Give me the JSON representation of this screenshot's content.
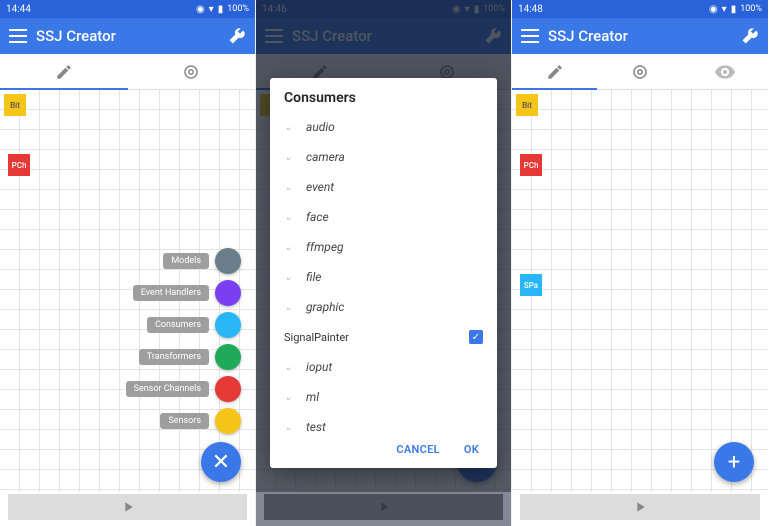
{
  "screens": [
    {
      "time": "14:44",
      "battery": "100%"
    },
    {
      "time": "14:46",
      "battery": "100%"
    },
    {
      "time": "14:48",
      "battery": "100%"
    }
  ],
  "app": {
    "title": "SSJ Creator"
  },
  "nodes": {
    "bit": "Bit",
    "pch": "PCh",
    "spa": "SPa"
  },
  "palette": [
    {
      "label": "Models",
      "color": "#6b7d8a"
    },
    {
      "label": "Event Handlers",
      "color": "#7b3ff2"
    },
    {
      "label": "Consumers",
      "color": "#29b6f6"
    },
    {
      "label": "Transformers",
      "color": "#1faa59"
    },
    {
      "label": "Sensor Channels",
      "color": "#e53935"
    },
    {
      "label": "Sensors",
      "color": "#f5c518"
    }
  ],
  "dialog": {
    "title": "Consumers",
    "items": [
      "audio",
      "camera",
      "event",
      "face",
      "ffmpeg",
      "file",
      "graphic"
    ],
    "selected": "SignalPainter",
    "itemsAfter": [
      "ioput",
      "ml",
      "test"
    ],
    "cancel": "CANCEL",
    "ok": "OK"
  },
  "fab": {
    "close": "✕",
    "add": "+"
  }
}
